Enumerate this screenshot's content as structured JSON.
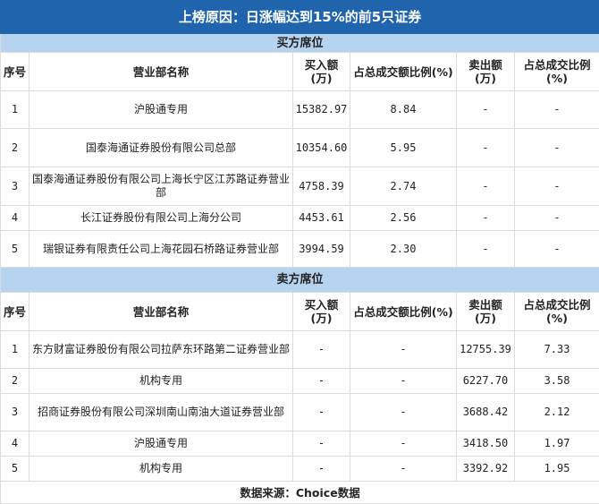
{
  "title": "上榜原因：日涨幅达到15%的前5只证券",
  "headers": [
    "序号",
    "营业部名称",
    "买入额(万)",
    "占总成交额比例(%)",
    "卖出额(万)",
    "占总成交比例(%)"
  ],
  "buy": {
    "label": "买方席位",
    "rows": [
      [
        "1",
        "沪股通专用",
        "15382.97",
        "8.84",
        "-",
        "-"
      ],
      [
        "2",
        "国泰海通证券股份有限公司总部",
        "10354.60",
        "5.95",
        "-",
        "-"
      ],
      [
        "3",
        "国泰海通证券股份有限公司上海长宁区江苏路证券营业部",
        "4758.39",
        "2.74",
        "-",
        "-"
      ],
      [
        "4",
        "长江证券股份有限公司上海分公司",
        "4453.61",
        "2.56",
        "-",
        "-"
      ],
      [
        "5",
        "瑞银证券有限责任公司上海花园石桥路证券营业部",
        "3994.59",
        "2.30",
        "-",
        "-"
      ]
    ]
  },
  "sell": {
    "label": "卖方席位",
    "rows": [
      [
        "1",
        "东方财富证券股份有限公司拉萨东环路第二证券营业部",
        "-",
        "-",
        "12755.39",
        "7.33"
      ],
      [
        "2",
        "机构专用",
        "-",
        "-",
        "6227.70",
        "3.58"
      ],
      [
        "3",
        "招商证券股份有限公司深圳南山南油大道证券营业部",
        "-",
        "-",
        "3688.42",
        "2.12"
      ],
      [
        "4",
        "沪股通专用",
        "-",
        "-",
        "3418.50",
        "1.97"
      ],
      [
        "5",
        "机构专用",
        "-",
        "-",
        "3392.92",
        "1.95"
      ]
    ]
  },
  "footer": "数据来源：Choice数据"
}
